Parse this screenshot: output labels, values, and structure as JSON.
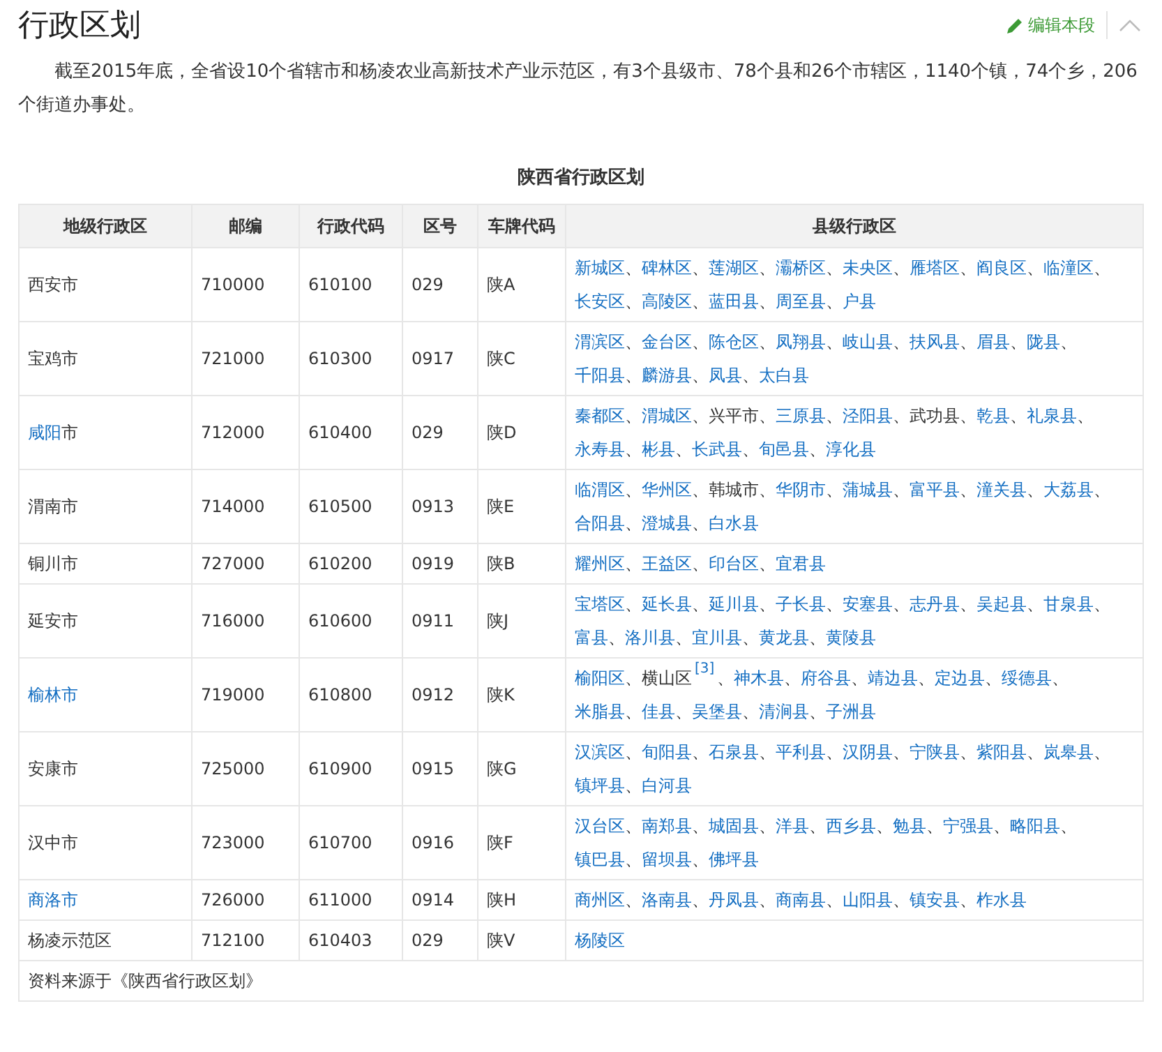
{
  "section": {
    "title": "行政区划",
    "edit_link": "编辑本段"
  },
  "paragraph": "截至2015年底，全省设10个省辖市和杨凌农业高新技术产业示范区，有3个县级市、78个县和26个市辖区，1140个镇，74个乡，206个街道办事处。",
  "table": {
    "caption": "陕西省行政区划",
    "columns": [
      "地级行政区",
      "邮编",
      "行政代码",
      "区号",
      "车牌代码",
      "县级行政区"
    ],
    "rows": [
      {
        "city": [
          {
            "kind": "plain",
            "text": "西安市"
          }
        ],
        "postcode": "710000",
        "admin_code": "610100",
        "area_code": "029",
        "plate": "陕A",
        "counties": [
          {
            "kind": "link",
            "text": "新城区"
          },
          {
            "kind": "sep",
            "text": "、"
          },
          {
            "kind": "link",
            "text": "碑林区"
          },
          {
            "kind": "sep",
            "text": "、"
          },
          {
            "kind": "link",
            "text": "莲湖区"
          },
          {
            "kind": "sep",
            "text": "、"
          },
          {
            "kind": "link",
            "text": "灞桥区"
          },
          {
            "kind": "sep",
            "text": "、"
          },
          {
            "kind": "link",
            "text": "未央区"
          },
          {
            "kind": "sep",
            "text": "、"
          },
          {
            "kind": "link",
            "text": "雁塔区"
          },
          {
            "kind": "sep",
            "text": "、"
          },
          {
            "kind": "link",
            "text": "阎良区"
          },
          {
            "kind": "sep",
            "text": "、"
          },
          {
            "kind": "link",
            "text": "临潼区"
          },
          {
            "kind": "sep",
            "text": "、"
          },
          {
            "kind": "link",
            "text": "长安区"
          },
          {
            "kind": "sep",
            "text": "、"
          },
          {
            "kind": "link",
            "text": "高陵区"
          },
          {
            "kind": "sep",
            "text": "、"
          },
          {
            "kind": "link",
            "text": "蓝田县"
          },
          {
            "kind": "sep",
            "text": "、"
          },
          {
            "kind": "link",
            "text": "周至县"
          },
          {
            "kind": "sep",
            "text": "、"
          },
          {
            "kind": "link",
            "text": "户县"
          }
        ]
      },
      {
        "city": [
          {
            "kind": "plain",
            "text": "宝鸡市"
          }
        ],
        "postcode": "721000",
        "admin_code": "610300",
        "area_code": "0917",
        "plate": "陕C",
        "counties": [
          {
            "kind": "link",
            "text": "渭滨区"
          },
          {
            "kind": "sep",
            "text": "、"
          },
          {
            "kind": "link",
            "text": "金台区"
          },
          {
            "kind": "sep",
            "text": "、"
          },
          {
            "kind": "link",
            "text": "陈仓区"
          },
          {
            "kind": "sep",
            "text": "、"
          },
          {
            "kind": "link",
            "text": "凤翔县"
          },
          {
            "kind": "sep",
            "text": "、"
          },
          {
            "kind": "link",
            "text": "岐山县"
          },
          {
            "kind": "sep",
            "text": "、"
          },
          {
            "kind": "link",
            "text": "扶风县"
          },
          {
            "kind": "sep",
            "text": "、"
          },
          {
            "kind": "link",
            "text": "眉县"
          },
          {
            "kind": "sep",
            "text": "、"
          },
          {
            "kind": "link",
            "text": "陇县"
          },
          {
            "kind": "sep",
            "text": "、"
          },
          {
            "kind": "link",
            "text": "千阳县"
          },
          {
            "kind": "sep",
            "text": "、"
          },
          {
            "kind": "link",
            "text": "麟游县"
          },
          {
            "kind": "sep",
            "text": "、"
          },
          {
            "kind": "link",
            "text": "凤县"
          },
          {
            "kind": "sep",
            "text": "、"
          },
          {
            "kind": "link",
            "text": "太白县"
          }
        ]
      },
      {
        "city": [
          {
            "kind": "link",
            "text": "咸阳"
          },
          {
            "kind": "plain",
            "text": "市"
          }
        ],
        "postcode": "712000",
        "admin_code": "610400",
        "area_code": "029",
        "plate": "陕D",
        "counties": [
          {
            "kind": "link",
            "text": "秦都区"
          },
          {
            "kind": "sep",
            "text": "、"
          },
          {
            "kind": "link",
            "text": "渭城区"
          },
          {
            "kind": "sep",
            "text": "、"
          },
          {
            "kind": "plain",
            "text": "兴平市"
          },
          {
            "kind": "sep",
            "text": "、"
          },
          {
            "kind": "link",
            "text": "三原县"
          },
          {
            "kind": "sep",
            "text": "、"
          },
          {
            "kind": "link",
            "text": "泾阳县"
          },
          {
            "kind": "sep",
            "text": "、"
          },
          {
            "kind": "plain",
            "text": "武功县"
          },
          {
            "kind": "sep",
            "text": "、"
          },
          {
            "kind": "link",
            "text": "乾县"
          },
          {
            "kind": "sep",
            "text": "、"
          },
          {
            "kind": "link",
            "text": "礼泉县"
          },
          {
            "kind": "sep",
            "text": "、"
          },
          {
            "kind": "link",
            "text": "永寿县"
          },
          {
            "kind": "sep",
            "text": "、"
          },
          {
            "kind": "link",
            "text": "彬县"
          },
          {
            "kind": "sep",
            "text": "、"
          },
          {
            "kind": "link",
            "text": "长武县"
          },
          {
            "kind": "sep",
            "text": "、"
          },
          {
            "kind": "link",
            "text": "旬邑县"
          },
          {
            "kind": "sep",
            "text": "、"
          },
          {
            "kind": "link",
            "text": "淳化县"
          }
        ]
      },
      {
        "city": [
          {
            "kind": "plain",
            "text": "渭南市"
          }
        ],
        "postcode": "714000",
        "admin_code": "610500",
        "area_code": "0913",
        "plate": "陕E",
        "counties": [
          {
            "kind": "link",
            "text": "临渭区"
          },
          {
            "kind": "sep",
            "text": "、"
          },
          {
            "kind": "link",
            "text": "华州区"
          },
          {
            "kind": "sep",
            "text": "、"
          },
          {
            "kind": "plain",
            "text": "韩城市"
          },
          {
            "kind": "sep",
            "text": "、"
          },
          {
            "kind": "link",
            "text": "华阴市"
          },
          {
            "kind": "sep",
            "text": "、"
          },
          {
            "kind": "link",
            "text": "蒲城县"
          },
          {
            "kind": "sep",
            "text": "、"
          },
          {
            "kind": "link",
            "text": "富平县"
          },
          {
            "kind": "sep",
            "text": "、"
          },
          {
            "kind": "link",
            "text": "潼关县"
          },
          {
            "kind": "sep",
            "text": "、"
          },
          {
            "kind": "link",
            "text": "大荔县"
          },
          {
            "kind": "sep",
            "text": "、"
          },
          {
            "kind": "link",
            "text": "合阳县"
          },
          {
            "kind": "sep",
            "text": "、"
          },
          {
            "kind": "link",
            "text": "澄城县"
          },
          {
            "kind": "sep",
            "text": "、"
          },
          {
            "kind": "link",
            "text": "白水县"
          }
        ]
      },
      {
        "city": [
          {
            "kind": "plain",
            "text": "铜川市"
          }
        ],
        "postcode": "727000",
        "admin_code": "610200",
        "area_code": "0919",
        "plate": "陕B",
        "counties": [
          {
            "kind": "link",
            "text": "耀州区"
          },
          {
            "kind": "sep",
            "text": "、"
          },
          {
            "kind": "link",
            "text": "王益区"
          },
          {
            "kind": "sep",
            "text": "、"
          },
          {
            "kind": "link",
            "text": "印台区"
          },
          {
            "kind": "sep",
            "text": "、"
          },
          {
            "kind": "link",
            "text": "宜君县"
          }
        ]
      },
      {
        "city": [
          {
            "kind": "plain",
            "text": "延安市"
          }
        ],
        "postcode": "716000",
        "admin_code": "610600",
        "area_code": "0911",
        "plate": "陕J",
        "counties": [
          {
            "kind": "link",
            "text": "宝塔区"
          },
          {
            "kind": "sep",
            "text": "、"
          },
          {
            "kind": "link",
            "text": "延长县"
          },
          {
            "kind": "sep",
            "text": "、"
          },
          {
            "kind": "link",
            "text": "延川县"
          },
          {
            "kind": "sep",
            "text": "、"
          },
          {
            "kind": "link",
            "text": "子长县"
          },
          {
            "kind": "sep",
            "text": "、"
          },
          {
            "kind": "link",
            "text": "安塞县"
          },
          {
            "kind": "sep",
            "text": "、"
          },
          {
            "kind": "link",
            "text": "志丹县"
          },
          {
            "kind": "sep",
            "text": "、"
          },
          {
            "kind": "link",
            "text": "吴起县"
          },
          {
            "kind": "sep",
            "text": "、"
          },
          {
            "kind": "link",
            "text": "甘泉县"
          },
          {
            "kind": "sep",
            "text": "、"
          },
          {
            "kind": "link",
            "text": "富县"
          },
          {
            "kind": "sep",
            "text": "、"
          },
          {
            "kind": "link",
            "text": "洛川县"
          },
          {
            "kind": "sep",
            "text": "、"
          },
          {
            "kind": "link",
            "text": "宜川县"
          },
          {
            "kind": "sep",
            "text": "、"
          },
          {
            "kind": "link",
            "text": "黄龙县"
          },
          {
            "kind": "sep",
            "text": "、"
          },
          {
            "kind": "link",
            "text": "黄陵县"
          }
        ]
      },
      {
        "city": [
          {
            "kind": "link",
            "text": "榆林市"
          }
        ],
        "postcode": "719000",
        "admin_code": "610800",
        "area_code": "0912",
        "plate": "陕K",
        "counties": [
          {
            "kind": "link",
            "text": "榆阳区"
          },
          {
            "kind": "sep",
            "text": "、"
          },
          {
            "kind": "plain",
            "text": "横山区"
          },
          {
            "kind": "ref",
            "text": "[3]"
          },
          {
            "kind": "sep",
            "text": "、"
          },
          {
            "kind": "link",
            "text": "神木县"
          },
          {
            "kind": "sep",
            "text": "、"
          },
          {
            "kind": "link",
            "text": "府谷县"
          },
          {
            "kind": "sep",
            "text": "、"
          },
          {
            "kind": "link",
            "text": "靖边县"
          },
          {
            "kind": "sep",
            "text": "、"
          },
          {
            "kind": "link",
            "text": "定边县"
          },
          {
            "kind": "sep",
            "text": "、"
          },
          {
            "kind": "link",
            "text": "绥德县"
          },
          {
            "kind": "sep",
            "text": "、"
          },
          {
            "kind": "link",
            "text": "米脂县"
          },
          {
            "kind": "sep",
            "text": "、"
          },
          {
            "kind": "link",
            "text": "佳县"
          },
          {
            "kind": "sep",
            "text": "、"
          },
          {
            "kind": "link",
            "text": "吴堡县"
          },
          {
            "kind": "sep",
            "text": "、"
          },
          {
            "kind": "link",
            "text": "清涧县"
          },
          {
            "kind": "sep",
            "text": "、"
          },
          {
            "kind": "link",
            "text": "子洲县"
          }
        ]
      },
      {
        "city": [
          {
            "kind": "plain",
            "text": "安康市"
          }
        ],
        "postcode": "725000",
        "admin_code": "610900",
        "area_code": "0915",
        "plate": "陕G",
        "counties": [
          {
            "kind": "link",
            "text": "汉滨区"
          },
          {
            "kind": "sep",
            "text": "、"
          },
          {
            "kind": "link",
            "text": "旬阳县"
          },
          {
            "kind": "sep",
            "text": "、"
          },
          {
            "kind": "link",
            "text": "石泉县"
          },
          {
            "kind": "sep",
            "text": "、"
          },
          {
            "kind": "link",
            "text": "平利县"
          },
          {
            "kind": "sep",
            "text": "、"
          },
          {
            "kind": "link",
            "text": "汉阴县"
          },
          {
            "kind": "sep",
            "text": "、"
          },
          {
            "kind": "link",
            "text": "宁陕县"
          },
          {
            "kind": "sep",
            "text": "、"
          },
          {
            "kind": "link",
            "text": "紫阳县"
          },
          {
            "kind": "sep",
            "text": "、"
          },
          {
            "kind": "link",
            "text": "岚皋县"
          },
          {
            "kind": "sep",
            "text": "、"
          },
          {
            "kind": "link",
            "text": "镇坪县"
          },
          {
            "kind": "sep",
            "text": "、"
          },
          {
            "kind": "link",
            "text": "白河县"
          }
        ]
      },
      {
        "city": [
          {
            "kind": "plain",
            "text": "汉中市"
          }
        ],
        "postcode": "723000",
        "admin_code": "610700",
        "area_code": "0916",
        "plate": "陕F",
        "counties": [
          {
            "kind": "link",
            "text": "汉台区"
          },
          {
            "kind": "sep",
            "text": "、"
          },
          {
            "kind": "link",
            "text": "南郑县"
          },
          {
            "kind": "sep",
            "text": "、"
          },
          {
            "kind": "link",
            "text": "城固县"
          },
          {
            "kind": "sep",
            "text": "、"
          },
          {
            "kind": "link",
            "text": "洋县"
          },
          {
            "kind": "sep",
            "text": "、"
          },
          {
            "kind": "link",
            "text": "西乡县"
          },
          {
            "kind": "sep",
            "text": "、"
          },
          {
            "kind": "link",
            "text": "勉县"
          },
          {
            "kind": "sep",
            "text": "、"
          },
          {
            "kind": "link",
            "text": "宁强县"
          },
          {
            "kind": "sep",
            "text": "、"
          },
          {
            "kind": "link",
            "text": "略阳县"
          },
          {
            "kind": "sep",
            "text": "、"
          },
          {
            "kind": "link",
            "text": "镇巴县"
          },
          {
            "kind": "sep",
            "text": "、"
          },
          {
            "kind": "link",
            "text": "留坝县"
          },
          {
            "kind": "sep",
            "text": "、"
          },
          {
            "kind": "link",
            "text": "佛坪县"
          }
        ]
      },
      {
        "city": [
          {
            "kind": "link",
            "text": "商洛市"
          }
        ],
        "postcode": "726000",
        "admin_code": "611000",
        "area_code": "0914",
        "plate": "陕H",
        "counties": [
          {
            "kind": "link",
            "text": "商州区"
          },
          {
            "kind": "sep",
            "text": "、"
          },
          {
            "kind": "link",
            "text": "洛南县"
          },
          {
            "kind": "sep",
            "text": "、"
          },
          {
            "kind": "link",
            "text": "丹凤县"
          },
          {
            "kind": "sep",
            "text": "、"
          },
          {
            "kind": "link",
            "text": "商南县"
          },
          {
            "kind": "sep",
            "text": "、"
          },
          {
            "kind": "link",
            "text": "山阳县"
          },
          {
            "kind": "sep",
            "text": "、"
          },
          {
            "kind": "link",
            "text": "镇安县"
          },
          {
            "kind": "sep",
            "text": "、"
          },
          {
            "kind": "link",
            "text": "柞水县"
          }
        ]
      },
      {
        "city": [
          {
            "kind": "plain",
            "text": "杨凌示范区"
          }
        ],
        "postcode": "712100",
        "admin_code": "610403",
        "area_code": "029",
        "plate": "陕V",
        "counties": [
          {
            "kind": "link",
            "text": "杨陵区"
          }
        ]
      }
    ],
    "source_note": "资料来源于《陕西省行政区划》"
  }
}
